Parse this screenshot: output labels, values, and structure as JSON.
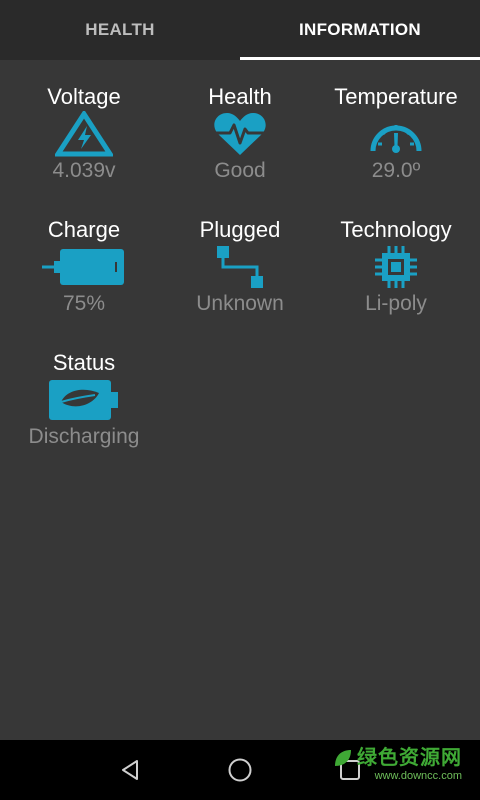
{
  "tabs": [
    {
      "label": "HEALTH",
      "active": false
    },
    {
      "label": "INFORMATION",
      "active": true
    }
  ],
  "colors": {
    "accent": "#1aa0c4",
    "background": "#373737",
    "tabbar": "#2a2a2a",
    "value_text": "#8c8c8c"
  },
  "info": {
    "voltage": {
      "label": "Voltage",
      "value": "4.039v",
      "icon": "voltage-warning-icon"
    },
    "health": {
      "label": "Health",
      "value": "Good",
      "icon": "heart-pulse-icon"
    },
    "temperature": {
      "label": "Temperature",
      "value": "29.0º",
      "icon": "gauge-icon"
    },
    "charge": {
      "label": "Charge",
      "value": "75%",
      "icon": "battery-icon"
    },
    "plugged": {
      "label": "Plugged",
      "value": "Unknown",
      "icon": "connection-icon"
    },
    "technology": {
      "label": "Technology",
      "value": "Li-poly",
      "icon": "chip-icon"
    },
    "status": {
      "label": "Status",
      "value": "Discharging",
      "icon": "battery-leaf-icon"
    }
  },
  "navbar": {
    "icons": [
      "back-icon",
      "home-icon",
      "recents-icon"
    ]
  },
  "watermark": {
    "logo_text": "绿色资源网",
    "url": "www.downcc.com"
  }
}
